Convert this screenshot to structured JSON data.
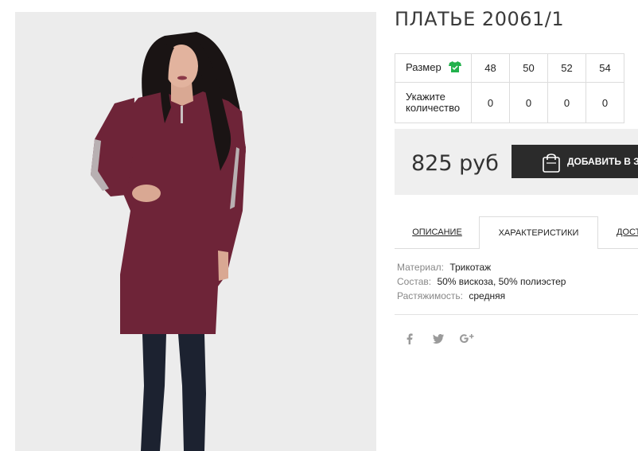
{
  "product": {
    "title": "ПЛАТЬЕ 20061/1",
    "image_alt": "Модель в бордовом платье и чёрных сапогах"
  },
  "sizes_table": {
    "size_label": "Размер",
    "size_icon": "tshirt-icon",
    "size_icon_color": "#22b14c",
    "quantity_label": "Укажите количество",
    "sizes": [
      "48",
      "50",
      "52",
      "54"
    ],
    "quantities": [
      "0",
      "0",
      "0",
      "0"
    ]
  },
  "purchase": {
    "price": "825 руб",
    "add_to_cart_label": "ДОБАВИТЬ В ЗАКАЗ",
    "bag_icon": "shopping-bag-icon"
  },
  "tabs": [
    {
      "label": "ОПИСАНИЕ",
      "active": false
    },
    {
      "label": "ХАРАКТЕРИСТИКИ",
      "active": true
    },
    {
      "label": "ДОСТАВКА",
      "active": false
    }
  ],
  "characteristics": [
    {
      "key": "Материал:",
      "value": "Трикотаж"
    },
    {
      "key": "Состав:",
      "value": "50% вискоза, 50% полиэстер"
    },
    {
      "key": "Растяжимость:",
      "value": "средняя"
    }
  ],
  "social": [
    "facebook-icon",
    "twitter-icon",
    "google-plus-icon"
  ],
  "colors": {
    "dress": "#6e2438",
    "boots": "#1c2230",
    "photo_bg": "#ececec",
    "button_bg": "#2b2b2b",
    "buy_panel_bg": "#efefef"
  }
}
